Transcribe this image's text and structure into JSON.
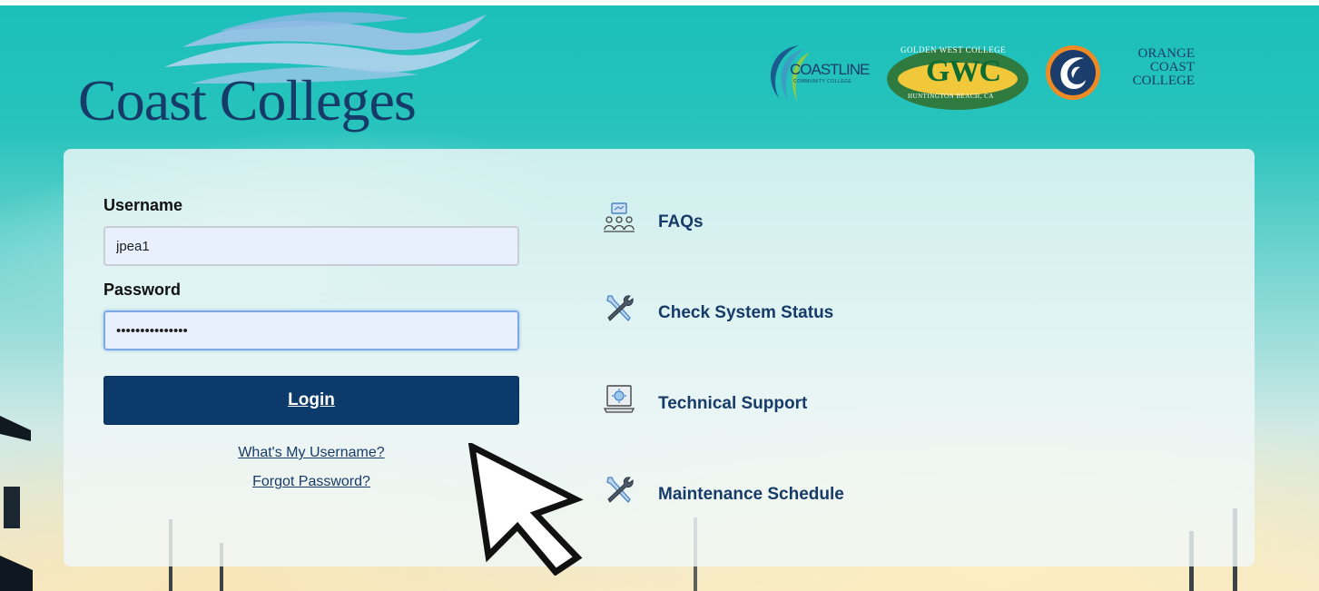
{
  "brand": {
    "title": "Coast Colleges",
    "primary_color": "#173b68"
  },
  "partners": {
    "coastline": {
      "name": "COASTLINE",
      "sub": "COMMUNITY COLLEGE"
    },
    "gwc": {
      "top": "GOLDEN WEST COLLEGE",
      "name": "GWC",
      "bottom": "HUNTINGTON BEACH, CA"
    },
    "occ": {
      "line1": "ORANGE",
      "line2": "COAST",
      "line3": "COLLEGE"
    }
  },
  "form": {
    "username_label": "Username",
    "username_value": "jpea1",
    "password_label": "Password",
    "password_value": "•••••••••••••••",
    "login_label": "Login",
    "login_color": "#0c3a6b",
    "links": {
      "whats_my_username": "What's My Username?",
      "forgot_password": "Forgot Password?"
    }
  },
  "menu": {
    "items": [
      {
        "label": "FAQs",
        "icon": "faq-people-icon"
      },
      {
        "label": "Check System Status",
        "icon": "tools-icon"
      },
      {
        "label": "Technical Support",
        "icon": "laptop-support-icon"
      },
      {
        "label": "Maintenance Schedule",
        "icon": "tools-icon"
      }
    ]
  }
}
